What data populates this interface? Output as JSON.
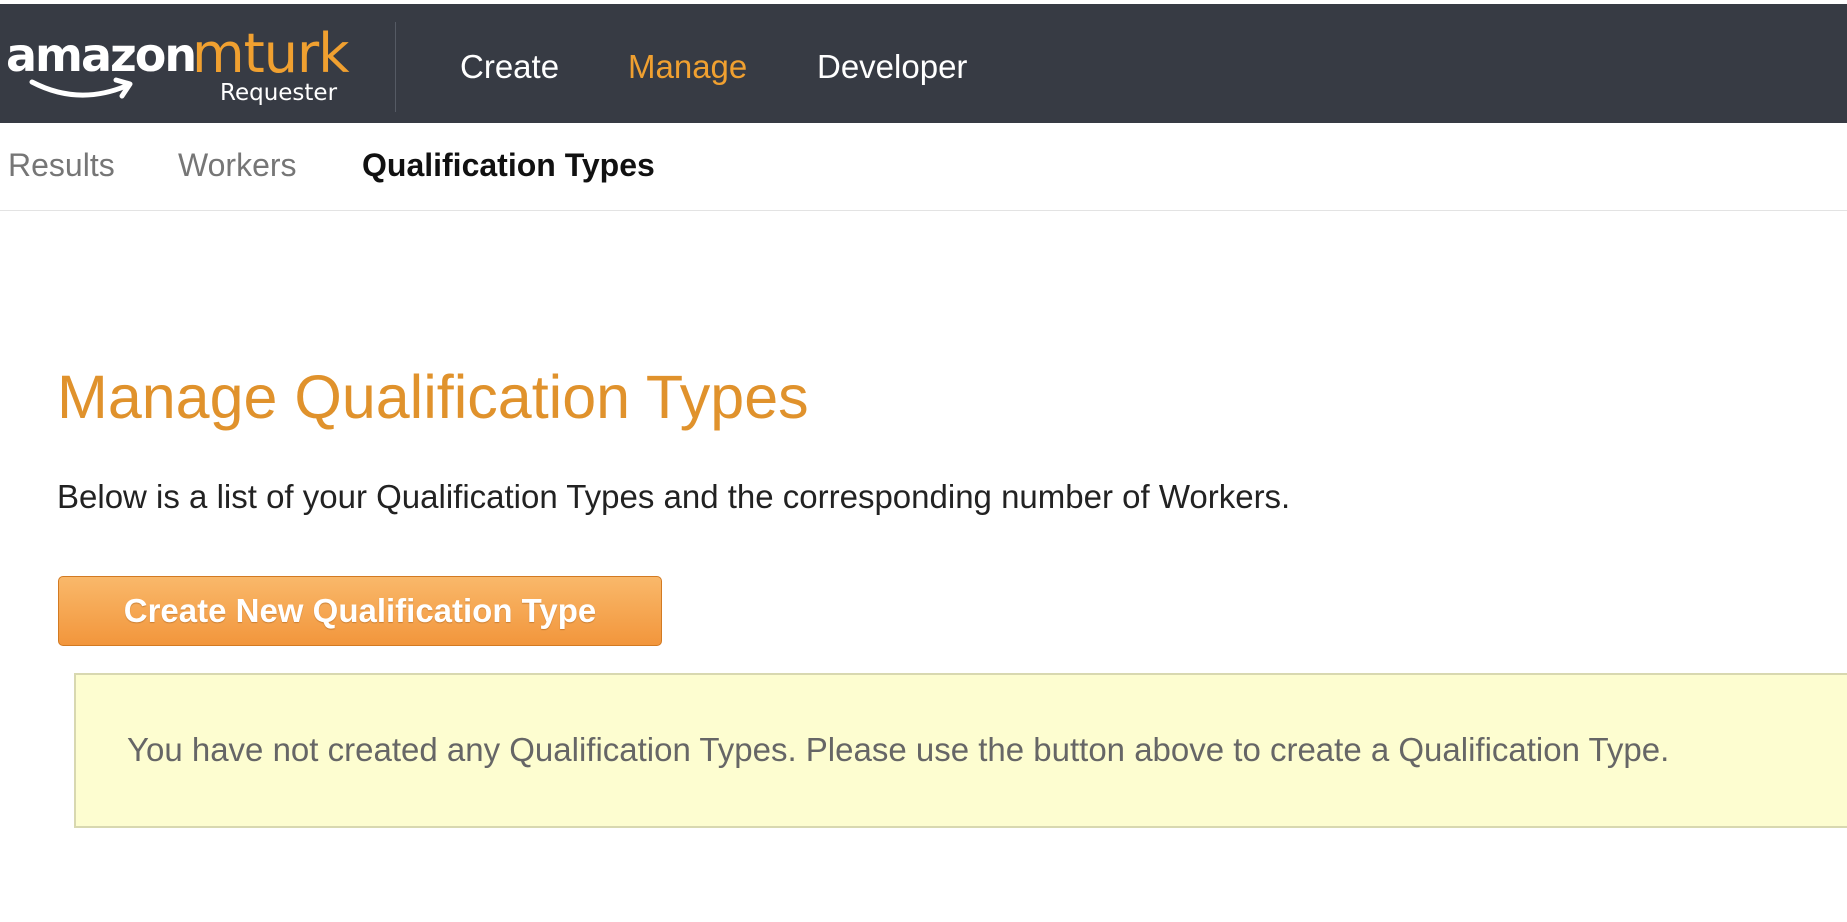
{
  "brand": {
    "logo_word": "amazon",
    "logo_product": "mturk",
    "logo_sub": "Requester",
    "accent_color": "#f0a030"
  },
  "main_nav": {
    "items": [
      {
        "label": "Create",
        "active": false
      },
      {
        "label": "Manage",
        "active": true
      },
      {
        "label": "Developer",
        "active": false
      }
    ]
  },
  "sub_nav": {
    "items": [
      {
        "label": "Results",
        "active": false
      },
      {
        "label": "Workers",
        "active": false
      },
      {
        "label": "Qualification Types",
        "active": true
      }
    ]
  },
  "page": {
    "title": "Manage Qualification Types",
    "intro": "Below is a list of your Qualification Types and the corresponding number of Workers.",
    "create_button_label": "Create New Qualification Type",
    "notice": "You have not created any Qualification Types. Please use the button above to create a Qualification Type."
  }
}
